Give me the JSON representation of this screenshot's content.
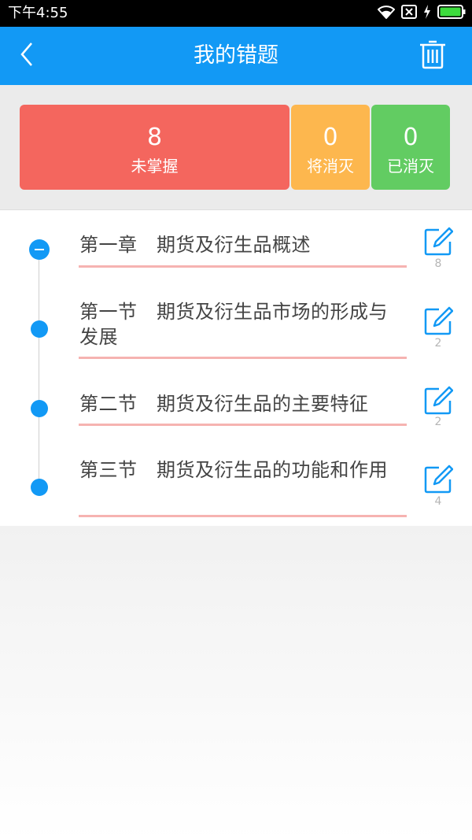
{
  "status_bar": {
    "time": "下午4:55",
    "icons": [
      "wifi-icon",
      "sim-off-icon",
      "charging-icon",
      "battery-icon"
    ],
    "battery_color": "#3ddc3d"
  },
  "header": {
    "title": "我的错题",
    "background": "#1299f5",
    "back_icon": "chevron-left-icon",
    "delete_icon": "trash-icon"
  },
  "stats": [
    {
      "count": "8",
      "label": "未掌握",
      "color": "#f4665e"
    },
    {
      "count": "0",
      "label": "将消灭",
      "color": "#fdb74e"
    },
    {
      "count": "0",
      "label": "已消灭",
      "color": "#62cc62"
    }
  ],
  "chapters": [
    {
      "title": "第一章　期货及衍生品概述",
      "count": "8",
      "marker": "minus"
    },
    {
      "title": "第一节　期货及衍生品市场的形成与发展",
      "count": "2",
      "marker": "dot"
    },
    {
      "title": "第二节　期货及衍生品的主要特征",
      "count": "2",
      "marker": "dot"
    },
    {
      "title": "第三节　期货及衍生品的功能和作用",
      "count": "4",
      "marker": "dot"
    }
  ],
  "colors": {
    "accent": "#1299f5",
    "underline": "#f6b3b1",
    "title_text": "#444444",
    "count_text": "#b5b5b5"
  }
}
